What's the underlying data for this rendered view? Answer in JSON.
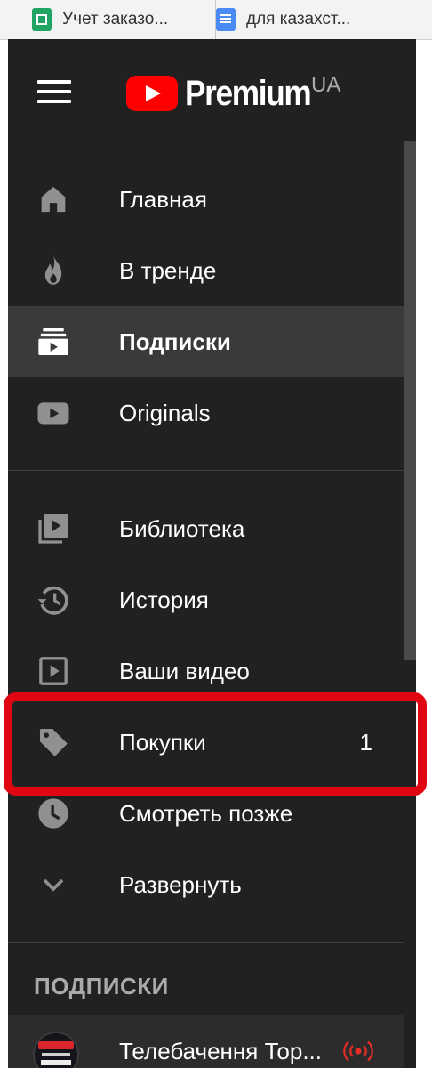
{
  "browser_tabs": [
    {
      "label": "Учет заказо...",
      "icon": "sheets-icon"
    },
    {
      "label": "для казахст...",
      "icon": "docs-icon"
    }
  ],
  "header": {
    "logo_text": "Premium",
    "country_code": "UA"
  },
  "nav_primary": [
    {
      "label": "Главная",
      "icon": "home-icon"
    },
    {
      "label": "В тренде",
      "icon": "trending-icon"
    },
    {
      "label": "Подписки",
      "icon": "subscriptions-icon",
      "active": true
    },
    {
      "label": "Originals",
      "icon": "originals-icon"
    }
  ],
  "nav_library": [
    {
      "label": "Библиотека",
      "icon": "library-icon"
    },
    {
      "label": "История",
      "icon": "history-icon"
    },
    {
      "label": "Ваши видео",
      "icon": "your-videos-icon"
    },
    {
      "label": "Покупки",
      "icon": "purchases-tag-icon",
      "count": "1",
      "highlighted": true
    },
    {
      "label": "Смотреть позже",
      "icon": "watch-later-icon"
    },
    {
      "label": "Развернуть",
      "icon": "chevron-down-icon"
    }
  ],
  "subscriptions": {
    "title": "ПОДПИСКИ",
    "items": [
      {
        "label": "Телебачення Тор...",
        "live": true
      }
    ]
  },
  "colors": {
    "background": "#212121",
    "active_row": "#3a3a3a",
    "highlight_frame": "#e10712",
    "brand_red": "#ff0000",
    "live_red": "#e52d27"
  }
}
